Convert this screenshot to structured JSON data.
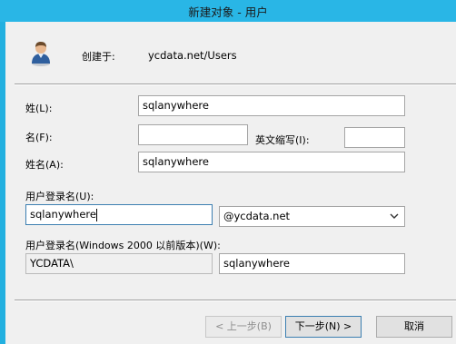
{
  "window": {
    "title": "新建对象 - 用户"
  },
  "header": {
    "icon": "user-icon",
    "created_in_label": "创建于:",
    "created_in_value": "ycdata.net/Users"
  },
  "form": {
    "last_name": {
      "label": "姓(L):",
      "value": "sqlanywhere"
    },
    "first_name": {
      "label": "名(F):",
      "value": ""
    },
    "initials": {
      "label": "英文缩写(I):",
      "value": ""
    },
    "full_name": {
      "label": "姓名(A):",
      "value": "sqlanywhere"
    },
    "logon_name": {
      "label": "用户登录名(U):",
      "value": "sqlanywhere"
    },
    "domain_suffix": {
      "selected": "@ycdata.net",
      "icon": "chevron-down-icon"
    },
    "pre2000": {
      "label": "用户登录名(Windows 2000 以前版本)(W):",
      "domain": "YCDATA\\",
      "value": "sqlanywhere"
    }
  },
  "buttons": {
    "back": "< 上一步(B)",
    "next": "下一步(N) >",
    "cancel": "取消"
  },
  "colors": {
    "title_bar": "#29b6e6",
    "focus_border": "#3c7fb1",
    "dialog_bg": "#f0f0f0"
  }
}
